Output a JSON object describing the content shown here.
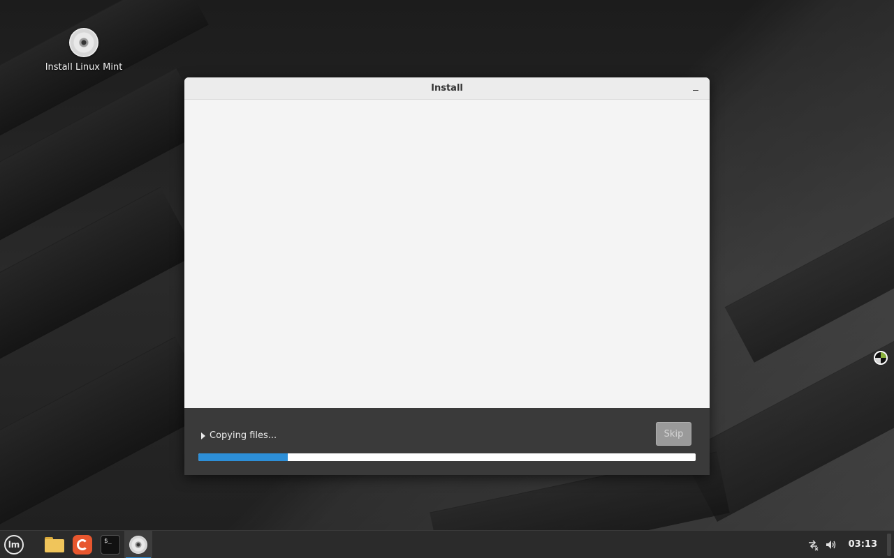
{
  "desktop": {
    "icons": [
      {
        "label": "Install Linux Mint",
        "icon": "disc-icon"
      }
    ]
  },
  "window": {
    "title": "Install",
    "status_text": "Copying files...",
    "skip_label": "Skip",
    "progress_fraction": 0.18
  },
  "taskbar": {
    "menu_label": "lm",
    "launchers": [
      {
        "name": "folder-icon"
      },
      {
        "name": "firefox-icon"
      },
      {
        "name": "terminal-icon",
        "glyph": "$_"
      },
      {
        "name": "disc-icon",
        "active": true
      }
    ],
    "tray": {
      "network_icon": "network-disconnected-icon",
      "volume_icon": "volume-icon",
      "clock": "03:13"
    }
  },
  "colors": {
    "accent": "#2d8fd8",
    "panel_bg": "#3a3a3a",
    "window_bg": "#f4f4f4"
  }
}
